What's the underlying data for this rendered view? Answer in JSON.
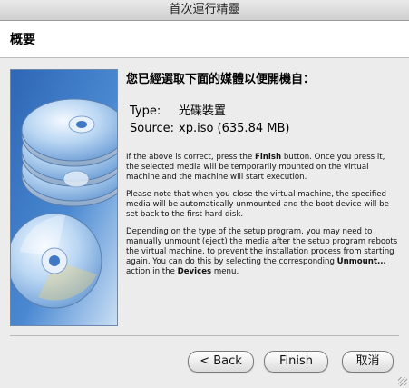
{
  "window": {
    "title": "首次運行精靈"
  },
  "header": {
    "title": "概要"
  },
  "content": {
    "headline": "您已經選取下面的媒體以便開機自：",
    "type_label": "Type:",
    "type_value": "光碟裝置",
    "source_label": "Source:",
    "source_value": "xp.iso (635.84 MB)",
    "para1_a": "If the above is correct, press the ",
    "para1_b": "Finish",
    "para1_c": " button. Once you press it, the selected media will be temporarily mounted on the virtual machine and the machine will start execution.",
    "para2": "Please note that when you close the virtual machine, the specified media will be automatically unmounted and the boot device will be set back to the first hard disk.",
    "para3_a": "Depending on the type of the setup program, you may need to manually unmount (eject) the media after the setup program reboots the virtual machine, to prevent the installation process from starting again. You can do this by selecting the corresponding ",
    "para3_b": "Unmount...",
    "para3_c": " action in the ",
    "para3_d": "Devices",
    "para3_e": " menu."
  },
  "buttons": {
    "back": "< Back",
    "finish": "Finish",
    "cancel": "取消"
  },
  "colors": {
    "side_image_bg": "#3f79c4",
    "disc": "#9ec3ea",
    "window_bg": "#ececec"
  },
  "icons": {
    "side_image": "cd-discs-illustration"
  }
}
